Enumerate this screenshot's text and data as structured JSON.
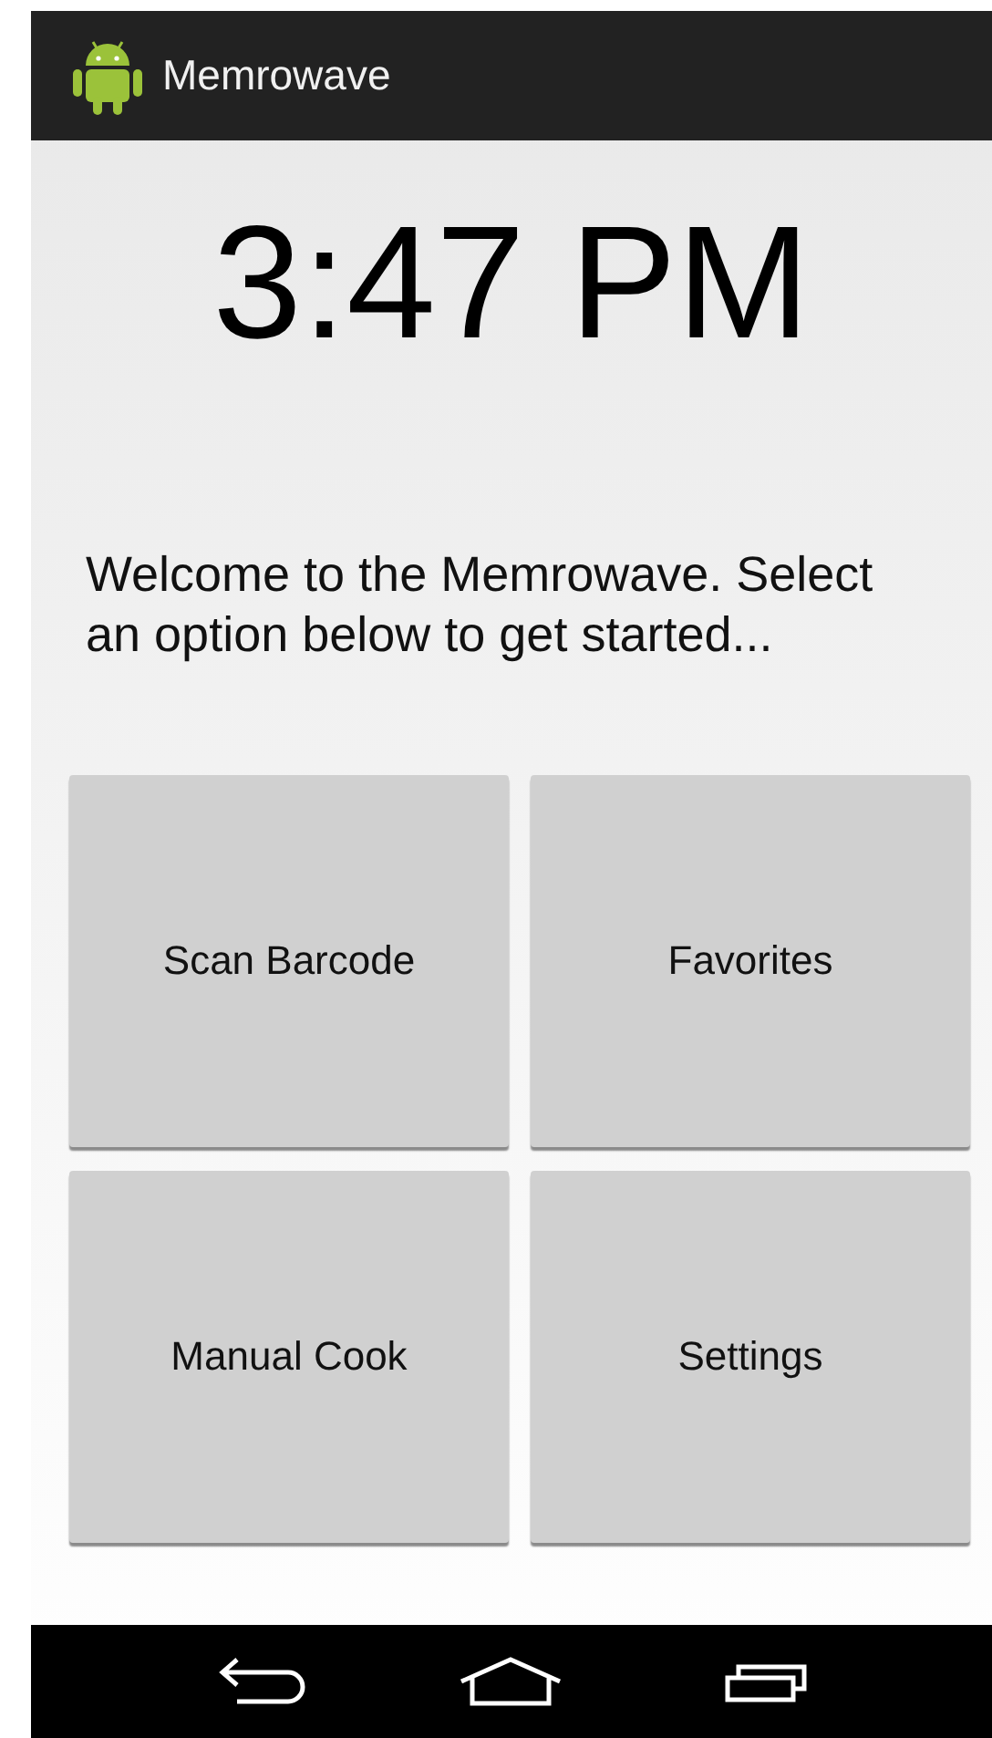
{
  "action_bar": {
    "title": "Memrowave"
  },
  "clock": "3:47 PM",
  "welcome": "Welcome to the Memrowave. Select an option below to get started...",
  "buttons": [
    {
      "label": "Scan Barcode"
    },
    {
      "label": "Favorites"
    },
    {
      "label": "Manual Cook"
    },
    {
      "label": "Settings"
    }
  ],
  "nav_bar": [
    {
      "kind": "back"
    },
    {
      "kind": "home"
    },
    {
      "kind": "recents"
    }
  ]
}
